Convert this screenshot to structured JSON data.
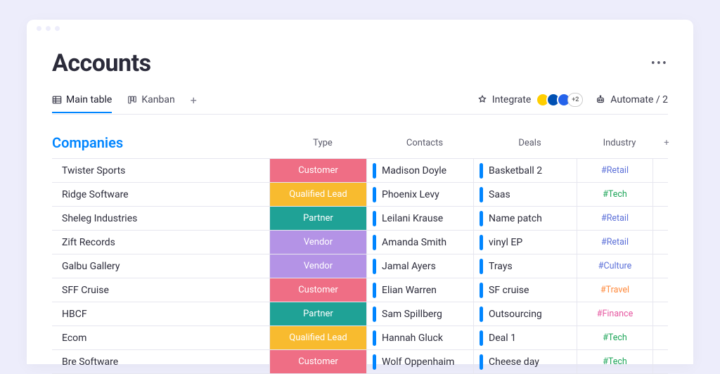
{
  "page": {
    "title": "Accounts"
  },
  "tabs": {
    "main": "Main table",
    "kanban": "Kanban"
  },
  "toolbar": {
    "integrate": "Integrate",
    "integrations_more": "+2",
    "automate": "Automate / 2"
  },
  "group": {
    "title": "Companies"
  },
  "columns": {
    "type": "Type",
    "contacts": "Contacts",
    "deals": "Deals",
    "industry": "Industry"
  },
  "type_colors": {
    "Customer": "#ef6e85",
    "Qualified Lead": "#f8bb2f",
    "Partner": "#1fa296",
    "Vendor": "#b493e6"
  },
  "industry_colors": {
    "#Retail": "#5b6fd8",
    "#Tech": "#1fa65a",
    "#Culture": "#5b6fd8",
    "#Travel": "#ff8a3d",
    "#Finance": "#e657a0"
  },
  "rows": [
    {
      "name": "Twister Sports",
      "type": "Customer",
      "contact": "Madison Doyle",
      "deal": "Basketball 2",
      "industry": "#Retail"
    },
    {
      "name": "Ridge Software",
      "type": "Qualified Lead",
      "contact": "Phoenix Levy",
      "deal": "Saas",
      "industry": "#Tech"
    },
    {
      "name": "Sheleg Industries",
      "type": "Partner",
      "contact": "Leilani Krause",
      "deal": "Name patch",
      "industry": "#Retail"
    },
    {
      "name": "Zift Records",
      "type": "Vendor",
      "contact": "Amanda Smith",
      "deal": "vinyl EP",
      "industry": "#Retail"
    },
    {
      "name": "Galbu Gallery",
      "type": "Vendor",
      "contact": "Jamal Ayers",
      "deal": "Trays",
      "industry": "#Culture"
    },
    {
      "name": "SFF Cruise",
      "type": "Customer",
      "contact": "Elian Warren",
      "deal": "SF cruise",
      "industry": "#Travel"
    },
    {
      "name": "HBCF",
      "type": "Partner",
      "contact": "Sam Spillberg",
      "deal": "Outsourcing",
      "industry": "#Finance"
    },
    {
      "name": "Ecom",
      "type": "Qualified Lead",
      "contact": "Hannah Gluck",
      "deal": "Deal 1",
      "industry": "#Tech"
    },
    {
      "name": "Bre Software",
      "type": "Customer",
      "contact": "Wolf Oppenhaim",
      "deal": "Cheese day",
      "industry": "#Tech"
    }
  ]
}
